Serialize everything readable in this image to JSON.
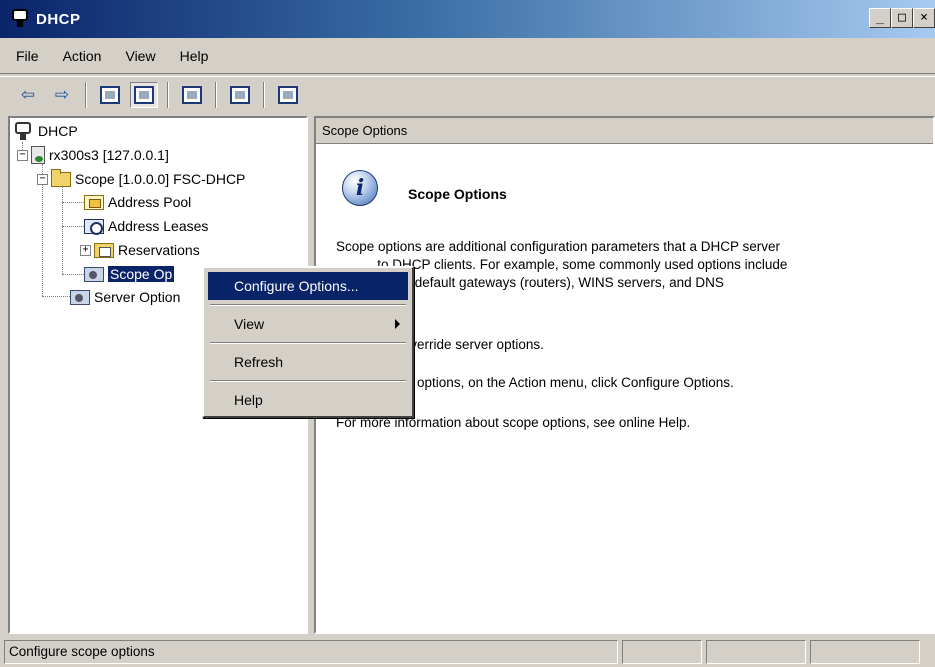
{
  "window": {
    "title": "DHCP",
    "minimize_glyph": "_",
    "restore_glyph": "□",
    "close_glyph": "×"
  },
  "menubar": {
    "items": [
      {
        "label": "File"
      },
      {
        "label": "Action"
      },
      {
        "label": "View"
      },
      {
        "label": "Help"
      }
    ]
  },
  "toolbar": {
    "back_glyph": "⇦",
    "forward_glyph": "⇨",
    "icons": [
      "back-icon",
      "forward-icon",
      "up-level-icon",
      "show-hide-tree-icon",
      "refresh-icon",
      "help-icon",
      "server-manage-icon"
    ]
  },
  "tree": {
    "root": "DHCP",
    "server": "rx300s3 [127.0.0.1]",
    "scope": "Scope [1.0.0.0] FSC-DHCP",
    "address_pool": "Address Pool",
    "address_leases": "Address Leases",
    "reservations": "Reservations",
    "scope_options": "Scope Op",
    "server_options": "Server Option",
    "expand_minus": "−",
    "expand_plus": "+"
  },
  "right_pane": {
    "header": "Scope Options",
    "info_glyph": "i",
    "title": "Scope Options",
    "para1_line1": "Scope options are additional configuration parameters that a DHCP server",
    "para1_line2": "           to DHCP clients. For example, some commonly used options include",
    "para1_line3": "           es for default gateways (routers), WINS servers, and DNS",
    "para2": "           ons override server options.",
    "para3": "           scope options, on the Action menu, click Configure Options.",
    "para4": "For more information about scope options, see online Help."
  },
  "context_menu": {
    "items": [
      {
        "label": "Configure Options..."
      },
      {
        "label": "View"
      },
      {
        "label": "Refresh"
      },
      {
        "label": "Help"
      }
    ]
  },
  "statusbar": {
    "text": "Configure scope options"
  },
  "colors": {
    "title_gradient_start": "#0a246a",
    "title_gradient_end": "#a6caf0",
    "selection": "#0a246a",
    "face": "#d4d0c8"
  }
}
